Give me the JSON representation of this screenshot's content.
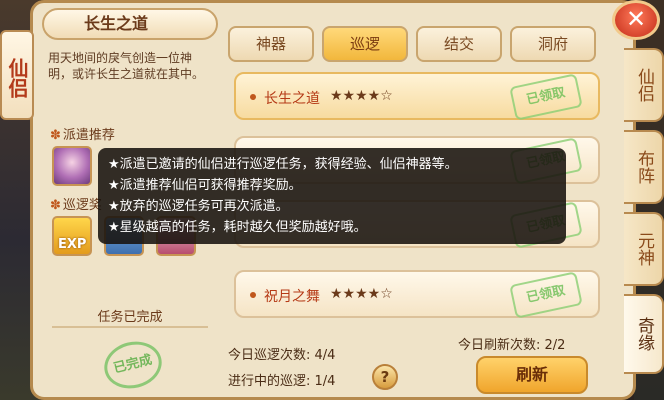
{
  "side_title": "仙侣",
  "left": {
    "heading": "长生之道",
    "description": "用天地间的戾气创造一位神明，或许长生之道就在其中。",
    "recommend_title": "派遣推荐",
    "patrol_title": "巡逻奖",
    "reward_exp_label": "EXP",
    "status": "任务已完成",
    "stamp": "已完成"
  },
  "tabs": [
    "神器",
    "巡逻",
    "结交",
    "洞府"
  ],
  "active_tab": "巡逻",
  "tasks": [
    {
      "name": "长生之道",
      "stars": "★★★★☆",
      "stamp": "已领取"
    },
    {
      "name": "",
      "stars": "",
      "stamp": "已领取"
    },
    {
      "name": "",
      "stars": "",
      "stamp": "已领取"
    },
    {
      "name": "祝月之舞",
      "stars": "★★★★☆",
      "stamp": "已领取"
    }
  ],
  "tooltip": [
    "★派遣已邀请的仙侣进行巡逻任务，获得经验、仙侣神器等。",
    "★派遣推荐仙侣可获得推荐奖励。",
    "★放弃的巡逻任务可再次派遣。",
    "★星级越高的任务，耗时越久但奖励越好哦。"
  ],
  "stats": {
    "today_patrol": "今日巡逻次数: 4/4",
    "in_progress": "进行中的巡逻: 1/4",
    "today_refresh": "今日刷新次数: 2/2"
  },
  "help_label": "?",
  "refresh_label": "刷新",
  "right_tabs": [
    "仙侣",
    "布阵",
    "元神",
    "奇缘"
  ],
  "close_label": "✕"
}
